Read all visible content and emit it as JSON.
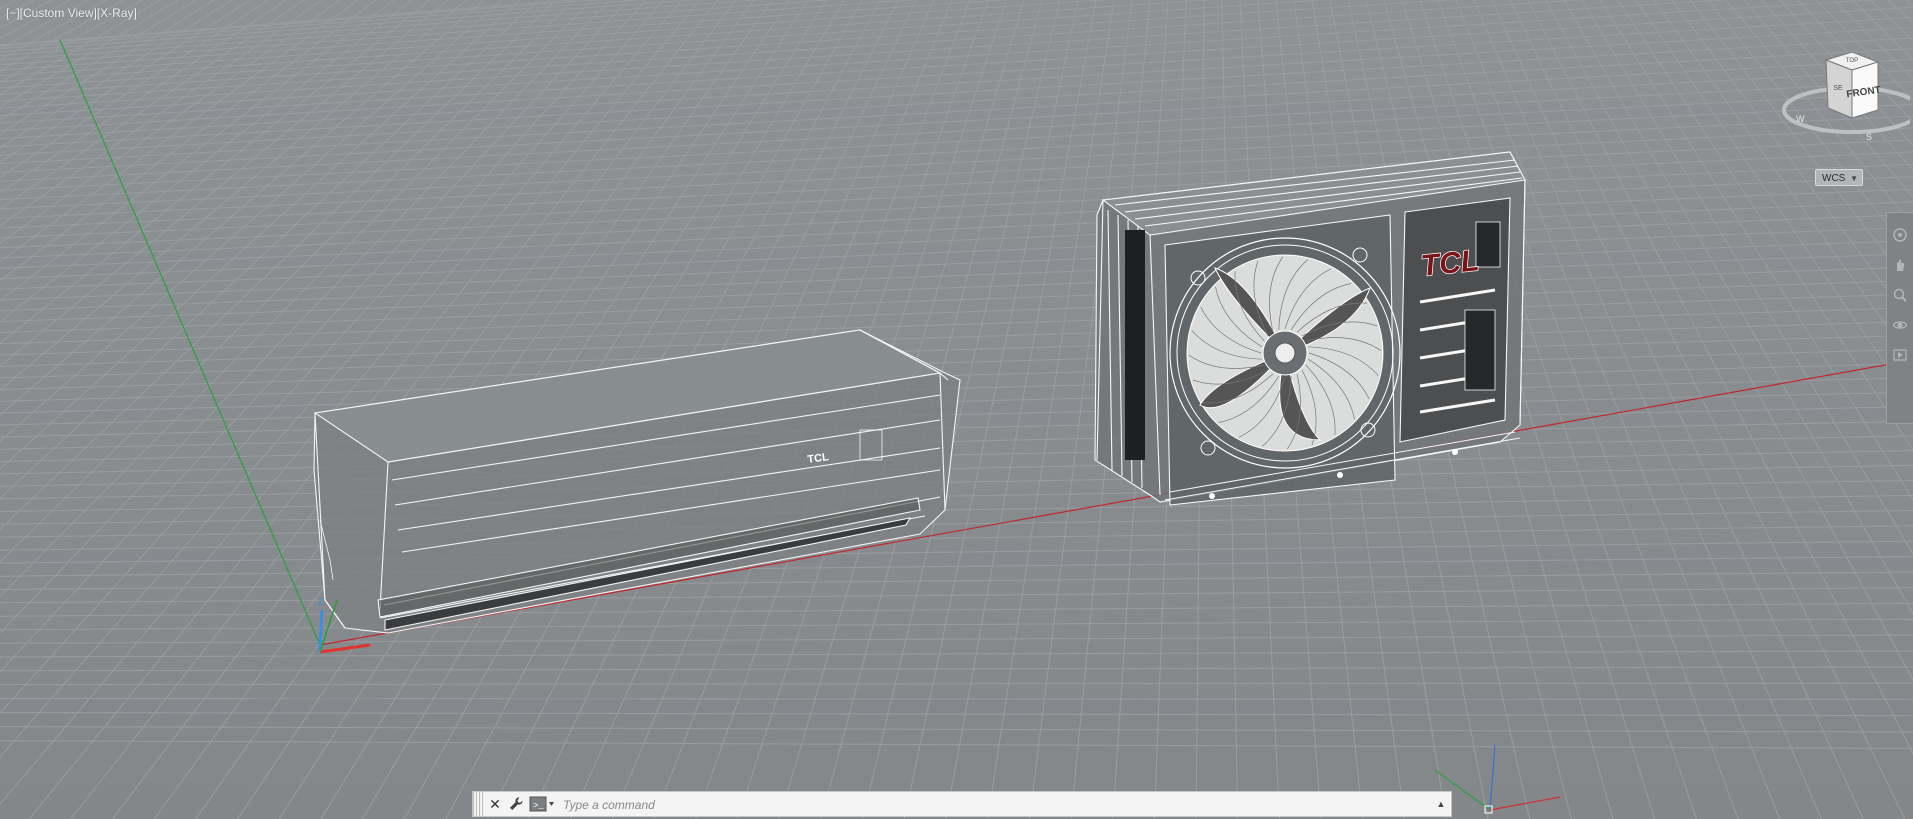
{
  "viewport": {
    "label": "[−][Custom View][X-Ray]",
    "background": "#85898c",
    "grid_color": "#9ca0a3",
    "x_axis_color": "#c0282a",
    "y_axis_color": "#2f9e3f"
  },
  "models": {
    "indoor_unit": {
      "brand": "TCL"
    },
    "outdoor_unit": {
      "brand": "TCL",
      "brand_color": "#7a1418"
    }
  },
  "viewcube": {
    "face_front": "FRONT",
    "face_top": "TOP",
    "face_side": "SE",
    "compass_w": "W",
    "compass_s": "S"
  },
  "wcs": {
    "label": "WCS"
  },
  "command_line": {
    "placeholder": "Type a command",
    "value": ""
  },
  "icons": {
    "close": "close-icon",
    "wrench": "wrench-icon",
    "prompt": "command-prompt-icon",
    "expand": "caret-up-icon"
  }
}
